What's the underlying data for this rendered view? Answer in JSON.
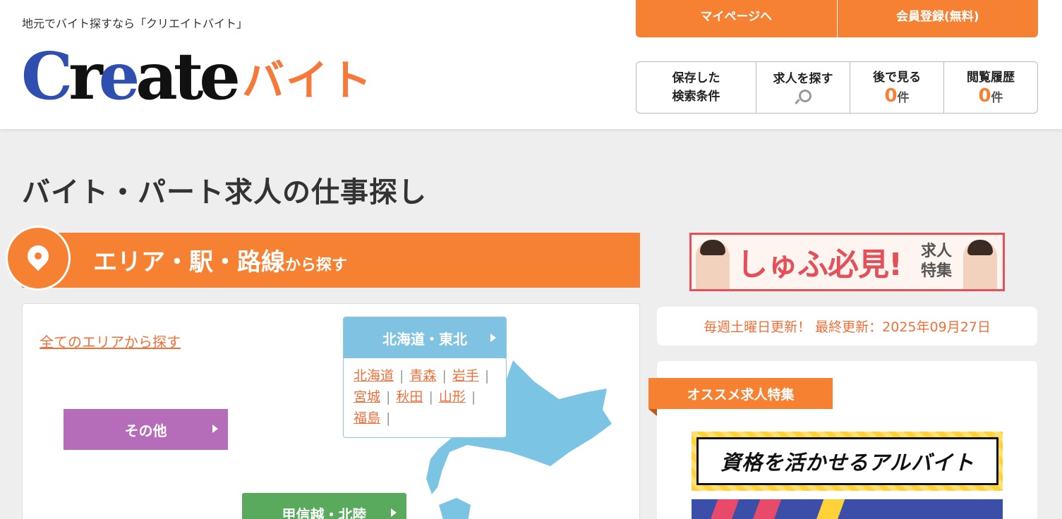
{
  "header": {
    "tagline": "地元でバイト探すなら「クリエイトバイト」",
    "logo_main": "Create",
    "logo_sub": "バイト",
    "top_buttons": [
      "マイページへ",
      "会員登録(無料)"
    ],
    "sub_nav": {
      "saved_line1": "保存した",
      "saved_line2": "検索条件",
      "search_label": "求人を探す",
      "later_label": "後で見る",
      "later_count": "0",
      "history_label": "閲覧履歴",
      "history_count": "0",
      "unit": "件"
    }
  },
  "main": {
    "page_title": "バイト・パート求人の仕事探し",
    "area_title": "エリア・駅・路線",
    "area_suffix": "から探す",
    "all_areas_link": "全てのエリアから探す",
    "region": {
      "name": "北海道・東北",
      "prefs": [
        "北海道",
        "青森",
        "岩手",
        "宮城",
        "秋田",
        "山形",
        "福島"
      ]
    },
    "other_button": "その他",
    "koshin_button": "甲信越・北陸"
  },
  "sidebar": {
    "banner_main": "しゅふ必見!",
    "banner_sub1": "求人",
    "banner_sub2": "特集",
    "update_text": "毎週土曜日更新！ 最終更新：2025年09月27日",
    "feature_tab": "オススメ求人特集",
    "qual_banner": "資格を活かせるアルバイト"
  },
  "colors": {
    "accent": "#f78132",
    "link": "#f0703a",
    "region_blue": "#7fc2e2",
    "other_purple": "#b56cb9",
    "koshin_green": "#5aaa5e"
  }
}
